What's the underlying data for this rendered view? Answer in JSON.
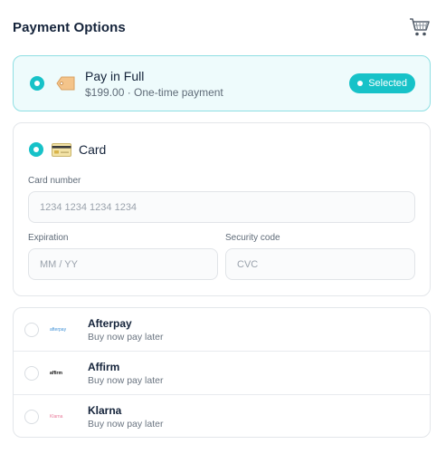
{
  "header": {
    "title": "Payment Options",
    "cart_icon": "shopping-cart-icon"
  },
  "full_payment": {
    "title": "Pay in Full",
    "subtitle": "$199.00 · One-time payment",
    "badge": "Selected",
    "icon": "price-tag-icon",
    "selected": true
  },
  "card": {
    "title": "Card",
    "icon": "credit-card-icon",
    "selected": true,
    "card_number": {
      "label": "Card number",
      "placeholder": "1234 1234 1234 1234"
    },
    "expiration": {
      "label": "Expiration",
      "placeholder": "MM / YY"
    },
    "security_code": {
      "label": "Security code",
      "placeholder": "CVC"
    }
  },
  "bnpl_options": [
    {
      "name": "Afterpay",
      "subtitle": "Buy now pay later",
      "logo": "afterpay",
      "selected": false
    },
    {
      "name": "Affirm",
      "subtitle": "Buy now pay later",
      "logo": "affirm",
      "selected": false
    },
    {
      "name": "Klarna",
      "subtitle": "Buy now pay later",
      "logo": "Klarna",
      "selected": false
    }
  ],
  "colors": {
    "accent": "#17c2c8",
    "selected_bg": "#eefbfc",
    "selected_border": "#8edfe3",
    "text_primary": "#14233a"
  }
}
